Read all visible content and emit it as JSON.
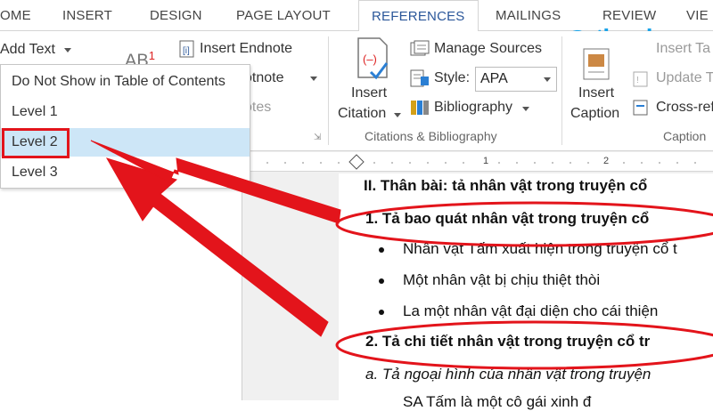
{
  "tabs": [
    "OME",
    "INSERT",
    "DESIGN",
    "PAGE LAYOUT",
    "REFERENCES",
    "MAILINGS",
    "REVIEW",
    "VIE"
  ],
  "ribbon": {
    "add_text": "Add Text",
    "insert_endnote": "Insert Endnote",
    "footnote_partial": "otnote",
    "notes_partial": "otes",
    "insert_citation": [
      "Insert",
      "Citation"
    ],
    "manage_sources": "Manage Sources",
    "style_label": "Style:",
    "style_value": "APA",
    "bibliography": "Bibliography",
    "group_citations": "Citations & Bibliography",
    "insert_caption": [
      "Insert",
      "Caption"
    ],
    "insert_table_partial": "Insert Ta",
    "update_table_partial": "Update Ta",
    "cross_ref_partial": "Cross-ref",
    "group_captions_partial": "Caption"
  },
  "menu": {
    "items": [
      "Do Not Show in Table of Contents",
      "Level 1",
      "Level 2",
      "Level 3"
    ],
    "selected": "Level 2"
  },
  "ruler": {
    "numbers": [
      "1",
      "2"
    ]
  },
  "document": {
    "heading": "II.  Thân bài: tả nhân vật trong truyện cổ",
    "section1": "1. Tả bao quát nhân vật trong truyện cổ",
    "bullets": [
      "Nhân vật Tấm xuất hiện trong truyện cổ t",
      "Một nhân vật bị chịu thiệt thòi",
      "La một nhân vật đại diện cho cái thiện"
    ],
    "section2": "2. Tả chi tiết nhân vật trong truyện cổ tr",
    "subsection_a": "a. Tả ngoại hình của nhân vật trong truyện",
    "partial_line": "SA Tấm là một cô gái xinh đ"
  },
  "logo": {
    "text": "ntbook"
  },
  "colors": {
    "accent": "#2b579a",
    "highlight": "#cde6f7",
    "annotation": "#e3141b",
    "logo": "#1aa3e8"
  }
}
